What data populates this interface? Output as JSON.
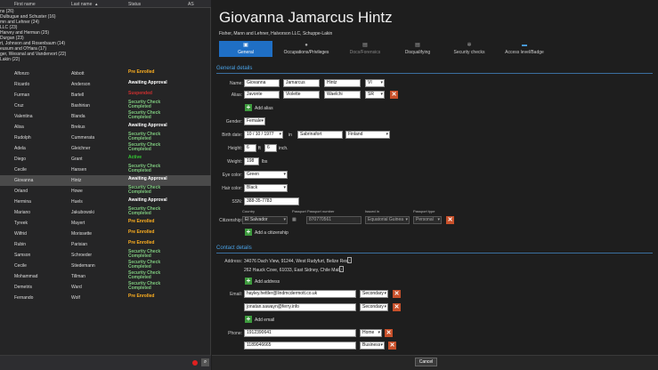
{
  "grid": {
    "headers": [
      "First name",
      "Last name",
      "Status",
      "AS"
    ],
    "groups": [
      "ns (26)",
      "Dulbugue and Schuster (16)",
      "mn and Lehner (24)",
      "LLC (23)",
      "Harvey and Herman (25)",
      "Durgan (23)",
      "rt, Johnson and Rosenbaum (14)",
      "eusum and O'Hara (17)",
      "ger, Wessnal and Vandervort (22)",
      "Lakin (22)"
    ],
    "rows": [
      {
        "first": "Alfonzo",
        "last": "Abbott",
        "status": "Pre Enrolled",
        "kind": "enrolled"
      },
      {
        "first": "Ricardo",
        "last": "Anderson",
        "status": "Awaiting Approval",
        "kind": "approval"
      },
      {
        "first": "Furman",
        "last": "Bartell",
        "status": "Suspended",
        "kind": "red"
      },
      {
        "first": "Cruz",
        "last": "Bashirian",
        "status": "Security Check Completed",
        "kind": "security"
      },
      {
        "first": "Valentina",
        "last": "Blanda",
        "status": "Security Check Completed",
        "kind": "security"
      },
      {
        "first": "Alisa",
        "last": "Brekus",
        "status": "Awaiting Approval",
        "kind": "approval"
      },
      {
        "first": "Rudolph",
        "last": "Cummerata",
        "status": "Security Check Completed",
        "kind": "security"
      },
      {
        "first": "Adela",
        "last": "Gleichner",
        "status": "Security Check Completed",
        "kind": "security"
      },
      {
        "first": "Diego",
        "last": "Grant",
        "status": "Active",
        "kind": "green"
      },
      {
        "first": "Cecile",
        "last": "Hansen",
        "status": "Security Check Completed",
        "kind": "security"
      },
      {
        "first": "Giovanna",
        "last": "Hintz",
        "status": "Awaiting Approval",
        "kind": "approval",
        "selected": true
      },
      {
        "first": "Orland",
        "last": "Howe",
        "status": "Security Check Completed",
        "kind": "security"
      },
      {
        "first": "Hermina",
        "last": "Huels",
        "status": "Awaiting Approval",
        "kind": "approval"
      },
      {
        "first": "Mariano",
        "last": "Jakubowski",
        "status": "Security Check Completed",
        "kind": "security"
      },
      {
        "first": "Tyreek",
        "last": "Mayert",
        "status": "Pre Enrolled",
        "kind": "enrolled"
      },
      {
        "first": "Wilfrid",
        "last": "Morissette",
        "status": "Pre Enrolled",
        "kind": "enrolled"
      },
      {
        "first": "Rubin",
        "last": "Parisian",
        "status": "Pre Enrolled",
        "kind": "enrolled"
      },
      {
        "first": "Samson",
        "last": "Schroeder",
        "status": "Security Check Completed",
        "kind": "security"
      },
      {
        "first": "Cecile",
        "last": "Stiedemann",
        "status": "Security Check Completed",
        "kind": "security"
      },
      {
        "first": "Mohammad",
        "last": "Tillman",
        "status": "Security Check Completed",
        "kind": "security"
      },
      {
        "first": "Demetris",
        "last": "Ward",
        "status": "Security Check Completed",
        "kind": "security"
      },
      {
        "first": "Fernando",
        "last": "Wolf",
        "status": "Pre Enrolled",
        "kind": "enrolled"
      }
    ]
  },
  "detail": {
    "name": "Giovanna Jamarcus Hintz",
    "subtitle": "Fisher, Mann and Lehner, Halvorson LLC, Schuppe-Lakin",
    "tabs": [
      "General",
      "Occupations/Privileges",
      "Docs/Forensics",
      "Disqualifying",
      "Security checks",
      "Access level/Badge"
    ],
    "sections": {
      "general": "General details",
      "contact": "Contact details"
    },
    "labels": {
      "name": "Name:",
      "alias": "Alias:",
      "gender": "Gender:",
      "birth": "Birth date:",
      "in": "in",
      "height": "Height:",
      "ft": "ft",
      "inch": "inch.",
      "weight": "Weight:",
      "lbs": "lbs",
      "eye": "Eye color:",
      "hair": "Hair color:",
      "ssn": "SSN:",
      "citizenship": "Citizenship:",
      "address": "Address:",
      "email": "Email:",
      "phone": "Phone:",
      "country": "Country",
      "passport": "Passport",
      "passport_number": "Passport number",
      "issued_in": "Issued in",
      "passport_type": "Passport type"
    },
    "values": {
      "first": "Giovanna",
      "middle": "Jamarcus",
      "last": "Hintz",
      "suffix": "VI",
      "alias_first": "Javonte",
      "alias_middle": "Violette",
      "alias_last": "Waelchi",
      "alias_suffix": "SR",
      "gender": "Female",
      "birth": "10 / 10 / 1977",
      "birth_city": "Sabrinafort",
      "birth_country": "Finland",
      "height_ft": "6",
      "height_in": "6",
      "weight": "198",
      "eye": "Green",
      "hair": "Black",
      "ssn": "388-35-7783",
      "cit_country": "El Salvador",
      "passport_number": "870770561",
      "issued_in": "Equatorial Guinea",
      "passport_type": "Personal",
      "address1": "34076 Dach View, 91244, West Rudyfurt, Belize Res.",
      "address2": "262 Hauck Cove, 61033, East Sidney, Chile Mail.",
      "email1": "hayley.hettler@lindmcdermott.co.uk",
      "email1_type": "Secondary",
      "email2": "jonatan.sawayn@ferry.info",
      "email2_type": "Secondary",
      "phone1": "1912390641",
      "phone1_type": "Home",
      "phone2": "1189046665",
      "phone2_type": "Business"
    },
    "actions": {
      "add_alias": "Add alias",
      "add_citizenship": "Add a citizenship",
      "add_address": "Add address",
      "add_email": "Add email",
      "cancel": "Cancel"
    }
  }
}
